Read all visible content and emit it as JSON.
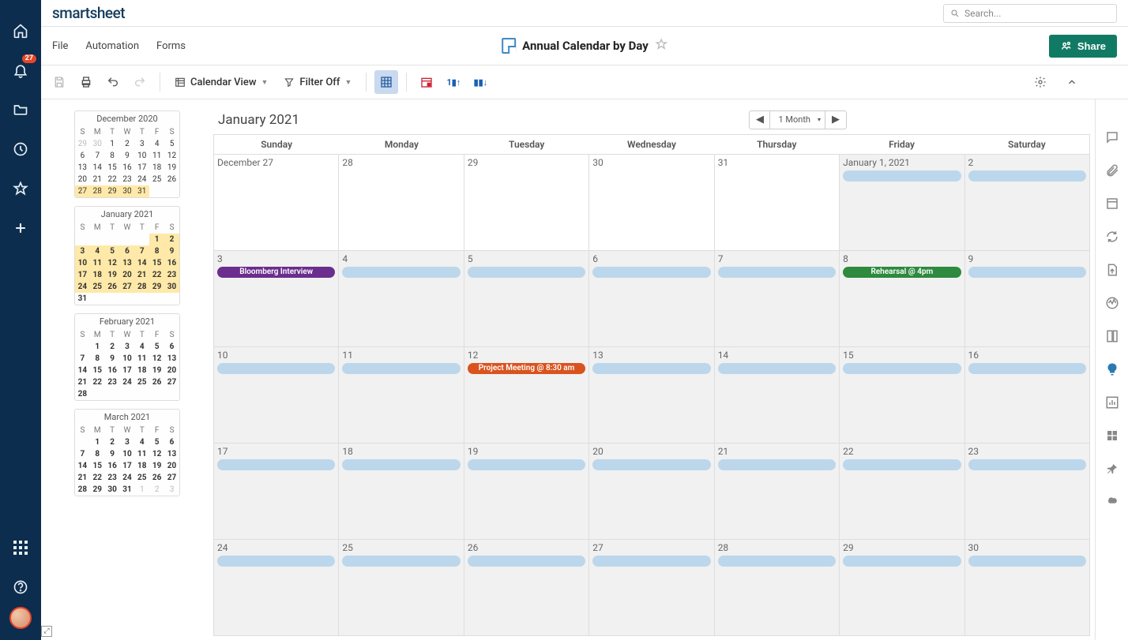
{
  "app": {
    "logo": "smartsheet",
    "search_placeholder": "Search..."
  },
  "notifications": {
    "count": "27"
  },
  "menu": {
    "file": "File",
    "automation": "Automation",
    "forms": "Forms"
  },
  "doc": {
    "title": "Annual Calendar by Day"
  },
  "share": {
    "label": "Share"
  },
  "toolbar": {
    "view": "Calendar View",
    "filter": "Filter Off",
    "range": "1 Month"
  },
  "calendar": {
    "title": "January 2021",
    "dow": [
      "Sunday",
      "Monday",
      "Tuesday",
      "Wednesday",
      "Thursday",
      "Friday",
      "Saturday"
    ],
    "weeks": [
      [
        {
          "label": "December 27",
          "out": true
        },
        {
          "label": "28",
          "out": true
        },
        {
          "label": "29",
          "out": true
        },
        {
          "label": "30",
          "out": true
        },
        {
          "label": "31",
          "out": true
        },
        {
          "label": "January 1, 2021",
          "events": [
            {
              "cls": "ev-blue",
              "text": ""
            }
          ]
        },
        {
          "label": "2",
          "events": [
            {
              "cls": "ev-blue",
              "text": ""
            }
          ]
        }
      ],
      [
        {
          "label": "3",
          "events": [
            {
              "cls": "ev-purple",
              "text": "Bloomberg Interview"
            }
          ]
        },
        {
          "label": "4",
          "events": [
            {
              "cls": "ev-blue",
              "text": ""
            }
          ]
        },
        {
          "label": "5",
          "events": [
            {
              "cls": "ev-blue",
              "text": ""
            }
          ]
        },
        {
          "label": "6",
          "events": [
            {
              "cls": "ev-blue",
              "text": ""
            }
          ]
        },
        {
          "label": "7",
          "events": [
            {
              "cls": "ev-blue",
              "text": ""
            }
          ]
        },
        {
          "label": "8",
          "events": [
            {
              "cls": "ev-green",
              "text": "Rehearsal @ 4pm"
            }
          ]
        },
        {
          "label": "9",
          "events": [
            {
              "cls": "ev-blue",
              "text": ""
            }
          ]
        }
      ],
      [
        {
          "label": "10",
          "events": [
            {
              "cls": "ev-blue",
              "text": ""
            }
          ]
        },
        {
          "label": "11",
          "events": [
            {
              "cls": "ev-blue",
              "text": ""
            }
          ]
        },
        {
          "label": "12",
          "events": [
            {
              "cls": "ev-orange",
              "text": "Project Meeting @ 8:30 am"
            }
          ]
        },
        {
          "label": "13",
          "events": [
            {
              "cls": "ev-blue",
              "text": ""
            }
          ]
        },
        {
          "label": "14",
          "events": [
            {
              "cls": "ev-blue",
              "text": ""
            }
          ]
        },
        {
          "label": "15",
          "events": [
            {
              "cls": "ev-blue",
              "text": ""
            }
          ]
        },
        {
          "label": "16",
          "events": [
            {
              "cls": "ev-blue",
              "text": ""
            }
          ]
        }
      ],
      [
        {
          "label": "17",
          "events": [
            {
              "cls": "ev-blue",
              "text": ""
            }
          ]
        },
        {
          "label": "18",
          "events": [
            {
              "cls": "ev-blue",
              "text": ""
            }
          ]
        },
        {
          "label": "19",
          "events": [
            {
              "cls": "ev-blue",
              "text": ""
            }
          ]
        },
        {
          "label": "20",
          "events": [
            {
              "cls": "ev-blue",
              "text": ""
            }
          ]
        },
        {
          "label": "21",
          "events": [
            {
              "cls": "ev-blue",
              "text": ""
            }
          ]
        },
        {
          "label": "22",
          "events": [
            {
              "cls": "ev-blue",
              "text": ""
            }
          ]
        },
        {
          "label": "23",
          "events": [
            {
              "cls": "ev-blue",
              "text": ""
            }
          ]
        }
      ],
      [
        {
          "label": "24",
          "events": [
            {
              "cls": "ev-blue",
              "text": ""
            }
          ]
        },
        {
          "label": "25",
          "events": [
            {
              "cls": "ev-blue",
              "text": ""
            }
          ]
        },
        {
          "label": "26",
          "events": [
            {
              "cls": "ev-blue",
              "text": ""
            }
          ]
        },
        {
          "label": "27",
          "events": [
            {
              "cls": "ev-blue",
              "text": ""
            }
          ]
        },
        {
          "label": "28",
          "events": [
            {
              "cls": "ev-blue",
              "text": ""
            }
          ]
        },
        {
          "label": "29",
          "events": [
            {
              "cls": "ev-blue",
              "text": ""
            }
          ]
        },
        {
          "label": "30",
          "events": [
            {
              "cls": "ev-blue",
              "text": ""
            }
          ]
        }
      ]
    ]
  },
  "mini": {
    "dow": [
      "S",
      "M",
      "T",
      "W",
      "T",
      "F",
      "S"
    ],
    "months": [
      {
        "title": "December 2020",
        "rows": [
          [
            {
              "t": "29",
              "d": 1
            },
            {
              "t": "30",
              "d": 1
            },
            {
              "t": "1"
            },
            {
              "t": "2"
            },
            {
              "t": "3"
            },
            {
              "t": "4"
            },
            {
              "t": "5"
            }
          ],
          [
            {
              "t": "6"
            },
            {
              "t": "7"
            },
            {
              "t": "8"
            },
            {
              "t": "9"
            },
            {
              "t": "10"
            },
            {
              "t": "11"
            },
            {
              "t": "12"
            }
          ],
          [
            {
              "t": "13"
            },
            {
              "t": "14"
            },
            {
              "t": "15"
            },
            {
              "t": "16"
            },
            {
              "t": "17"
            },
            {
              "t": "18"
            },
            {
              "t": "19"
            }
          ],
          [
            {
              "t": "20"
            },
            {
              "t": "21"
            },
            {
              "t": "22"
            },
            {
              "t": "23"
            },
            {
              "t": "24"
            },
            {
              "t": "25"
            },
            {
              "t": "26"
            }
          ],
          [
            {
              "t": "27",
              "h": 1
            },
            {
              "t": "28",
              "h": 1
            },
            {
              "t": "29",
              "h": 1
            },
            {
              "t": "30",
              "h": 1
            },
            {
              "t": "31",
              "h": 1
            },
            {
              "t": ""
            },
            {
              "t": ""
            }
          ]
        ]
      },
      {
        "title": "January 2021",
        "rows": [
          [
            {
              "t": ""
            },
            {
              "t": ""
            },
            {
              "t": ""
            },
            {
              "t": ""
            },
            {
              "t": ""
            },
            {
              "t": "1",
              "h": 1,
              "b": 1
            },
            {
              "t": "2",
              "h": 1,
              "b": 1
            }
          ],
          [
            {
              "t": "3",
              "h": 1,
              "b": 1
            },
            {
              "t": "4",
              "h": 1,
              "b": 1
            },
            {
              "t": "5",
              "h": 1,
              "b": 1
            },
            {
              "t": "6",
              "h": 1,
              "b": 1
            },
            {
              "t": "7",
              "h": 1,
              "b": 1
            },
            {
              "t": "8",
              "h": 1,
              "b": 1
            },
            {
              "t": "9",
              "h": 1,
              "b": 1
            }
          ],
          [
            {
              "t": "10",
              "h": 1,
              "b": 1
            },
            {
              "t": "11",
              "h": 1,
              "b": 1
            },
            {
              "t": "12",
              "h": 1,
              "b": 1
            },
            {
              "t": "13",
              "h": 1,
              "b": 1
            },
            {
              "t": "14",
              "h": 1,
              "b": 1
            },
            {
              "t": "15",
              "h": 1,
              "b": 1
            },
            {
              "t": "16",
              "h": 1,
              "b": 1
            }
          ],
          [
            {
              "t": "17",
              "h": 1,
              "b": 1
            },
            {
              "t": "18",
              "h": 1,
              "b": 1
            },
            {
              "t": "19",
              "h": 1,
              "b": 1
            },
            {
              "t": "20",
              "h": 1,
              "b": 1
            },
            {
              "t": "21",
              "h": 1,
              "b": 1
            },
            {
              "t": "22",
              "h": 1,
              "b": 1
            },
            {
              "t": "23",
              "h": 1,
              "b": 1
            }
          ],
          [
            {
              "t": "24",
              "h": 1,
              "b": 1
            },
            {
              "t": "25",
              "h": 1,
              "b": 1
            },
            {
              "t": "26",
              "h": 1,
              "b": 1
            },
            {
              "t": "27",
              "h": 1,
              "b": 1
            },
            {
              "t": "28",
              "h": 1,
              "b": 1
            },
            {
              "t": "29",
              "h": 1,
              "b": 1
            },
            {
              "t": "30",
              "h": 1,
              "b": 1
            }
          ],
          [
            {
              "t": "31",
              "b": 1
            },
            {
              "t": ""
            },
            {
              "t": ""
            },
            {
              "t": ""
            },
            {
              "t": ""
            },
            {
              "t": ""
            },
            {
              "t": ""
            }
          ]
        ]
      },
      {
        "title": "February 2021",
        "rows": [
          [
            {
              "t": ""
            },
            {
              "t": "1",
              "b": 1
            },
            {
              "t": "2",
              "b": 1
            },
            {
              "t": "3",
              "b": 1
            },
            {
              "t": "4",
              "b": 1
            },
            {
              "t": "5",
              "b": 1
            },
            {
              "t": "6",
              "b": 1
            }
          ],
          [
            {
              "t": "7",
              "b": 1
            },
            {
              "t": "8",
              "b": 1
            },
            {
              "t": "9",
              "b": 1
            },
            {
              "t": "10",
              "b": 1
            },
            {
              "t": "11",
              "b": 1
            },
            {
              "t": "12",
              "b": 1
            },
            {
              "t": "13",
              "b": 1
            }
          ],
          [
            {
              "t": "14",
              "b": 1
            },
            {
              "t": "15",
              "b": 1
            },
            {
              "t": "16",
              "b": 1
            },
            {
              "t": "17",
              "b": 1
            },
            {
              "t": "18",
              "b": 1
            },
            {
              "t": "19",
              "b": 1
            },
            {
              "t": "20",
              "b": 1
            }
          ],
          [
            {
              "t": "21",
              "b": 1
            },
            {
              "t": "22",
              "b": 1
            },
            {
              "t": "23",
              "b": 1
            },
            {
              "t": "24",
              "b": 1
            },
            {
              "t": "25",
              "b": 1
            },
            {
              "t": "26",
              "b": 1
            },
            {
              "t": "27",
              "b": 1
            }
          ],
          [
            {
              "t": "28",
              "b": 1
            },
            {
              "t": ""
            },
            {
              "t": ""
            },
            {
              "t": ""
            },
            {
              "t": ""
            },
            {
              "t": ""
            },
            {
              "t": ""
            }
          ]
        ]
      },
      {
        "title": "March 2021",
        "rows": [
          [
            {
              "t": ""
            },
            {
              "t": "1",
              "b": 1
            },
            {
              "t": "2",
              "b": 1
            },
            {
              "t": "3",
              "b": 1
            },
            {
              "t": "4",
              "b": 1
            },
            {
              "t": "5",
              "b": 1
            },
            {
              "t": "6",
              "b": 1
            }
          ],
          [
            {
              "t": "7",
              "b": 1
            },
            {
              "t": "8",
              "b": 1
            },
            {
              "t": "9",
              "b": 1
            },
            {
              "t": "10",
              "b": 1
            },
            {
              "t": "11",
              "b": 1
            },
            {
              "t": "12",
              "b": 1
            },
            {
              "t": "13",
              "b": 1
            }
          ],
          [
            {
              "t": "14",
              "b": 1
            },
            {
              "t": "15",
              "b": 1
            },
            {
              "t": "16",
              "b": 1
            },
            {
              "t": "17",
              "b": 1
            },
            {
              "t": "18",
              "b": 1
            },
            {
              "t": "19",
              "b": 1
            },
            {
              "t": "20",
              "b": 1
            }
          ],
          [
            {
              "t": "21",
              "b": 1
            },
            {
              "t": "22",
              "b": 1
            },
            {
              "t": "23",
              "b": 1
            },
            {
              "t": "24",
              "b": 1
            },
            {
              "t": "25",
              "b": 1
            },
            {
              "t": "26",
              "b": 1
            },
            {
              "t": "27",
              "b": 1
            }
          ],
          [
            {
              "t": "28",
              "b": 1
            },
            {
              "t": "29",
              "b": 1
            },
            {
              "t": "30",
              "b": 1
            },
            {
              "t": "31",
              "b": 1
            },
            {
              "t": "1",
              "d": 1
            },
            {
              "t": "2",
              "d": 1
            },
            {
              "t": "3",
              "d": 1
            }
          ]
        ]
      }
    ]
  }
}
